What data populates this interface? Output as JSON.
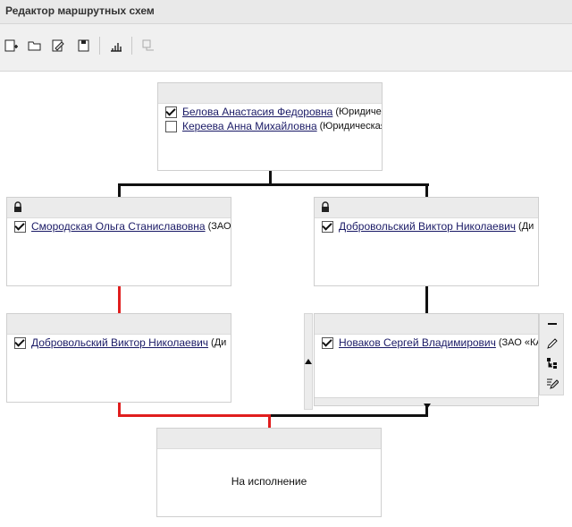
{
  "window": {
    "title": "Редактор маршрутных схем"
  },
  "toolbar": {
    "buttons": [
      {
        "icon": "new-scheme-icon"
      },
      {
        "icon": "open-folder-icon"
      },
      {
        "icon": "edit-scheme-icon"
      },
      {
        "icon": "save-icon"
      },
      {
        "icon": "layout-icon"
      },
      {
        "icon": "remove-node-icon",
        "disabled": true
      }
    ]
  },
  "nodes": {
    "top": {
      "rows": [
        {
          "checked": true,
          "name": "Белова Анастасия Федоровна",
          "org": "(Юридиче"
        },
        {
          "checked": false,
          "name": "Кереева Анна Михайловна",
          "org": "(Юридическая"
        }
      ]
    },
    "mid_left": {
      "locked": true,
      "rows": [
        {
          "checked": true,
          "name": "Смородская Ольга Станиславовна",
          "org": "(ЗАО"
        }
      ]
    },
    "mid_right": {
      "locked": true,
      "rows": [
        {
          "checked": true,
          "name": "Добровольский Виктор Николаевич",
          "org": "(Ди"
        }
      ]
    },
    "low_left": {
      "rows": [
        {
          "checked": true,
          "name": "Добровольский Виктор Николаевич",
          "org": "(Ди"
        }
      ]
    },
    "low_right": {
      "rows": [
        {
          "checked": true,
          "name": "Новаков Сергей Владимирович",
          "org": "(ЗАО «КА"
        }
      ]
    },
    "bottom": {
      "label": "На исполнение"
    }
  },
  "colors": {
    "connector": "#111111",
    "highlight_connector": "#e01e1e"
  },
  "side_tools": [
    "minus-icon",
    "edit-pencil-icon",
    "tree-icon",
    "edit-list-icon"
  ]
}
